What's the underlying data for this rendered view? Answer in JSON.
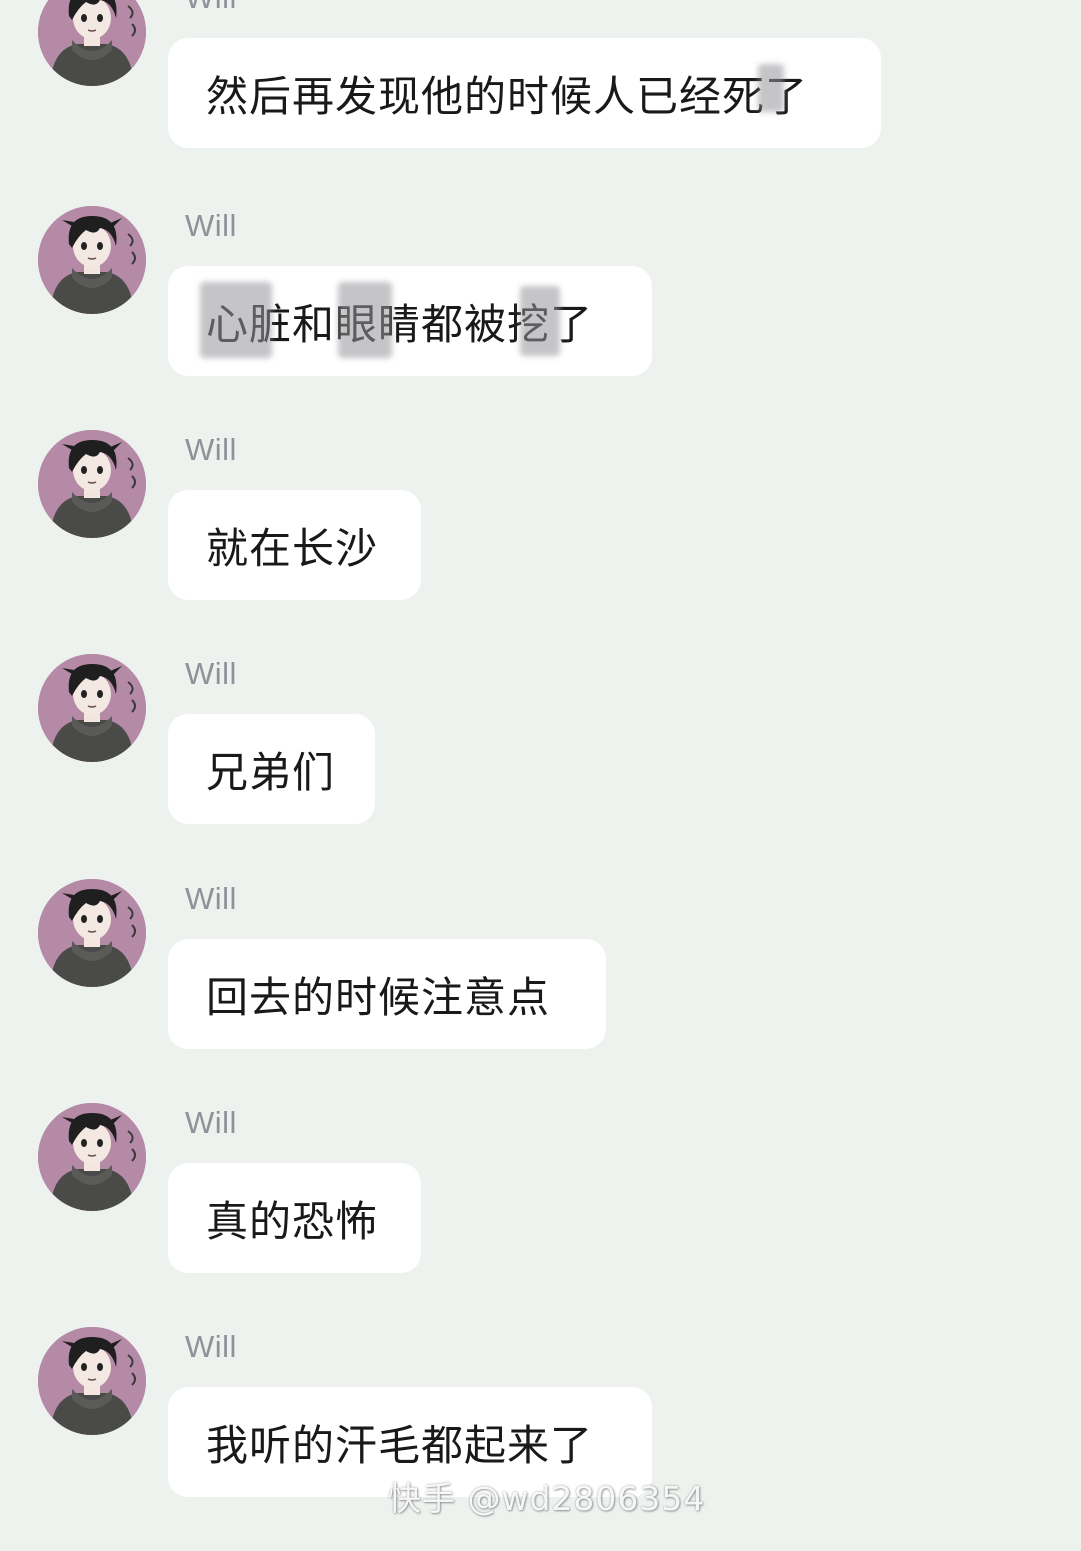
{
  "chat": {
    "colors": {
      "background": "#edf2ef",
      "bubble": "#ffffff",
      "sender": "#8e9299",
      "text": "#191919",
      "avatar_bg": "#b48aa6"
    },
    "messages": [
      {
        "sender": "Will",
        "text": "然后再发现他的时候人已经死了"
      },
      {
        "sender": "Will",
        "text": "心脏和眼睛都被挖了"
      },
      {
        "sender": "Will",
        "text": "就在长沙"
      },
      {
        "sender": "Will",
        "text": "兄弟们"
      },
      {
        "sender": "Will",
        "text": "回去的时候注意点"
      },
      {
        "sender": "Will",
        "text": "真的恐怖"
      },
      {
        "sender": "Will",
        "text": "我听的汗毛都起来了"
      }
    ],
    "avatar_icon": "anime-boy-hoodie-avatar"
  },
  "watermark": {
    "text": "快手 @wd2806354"
  }
}
